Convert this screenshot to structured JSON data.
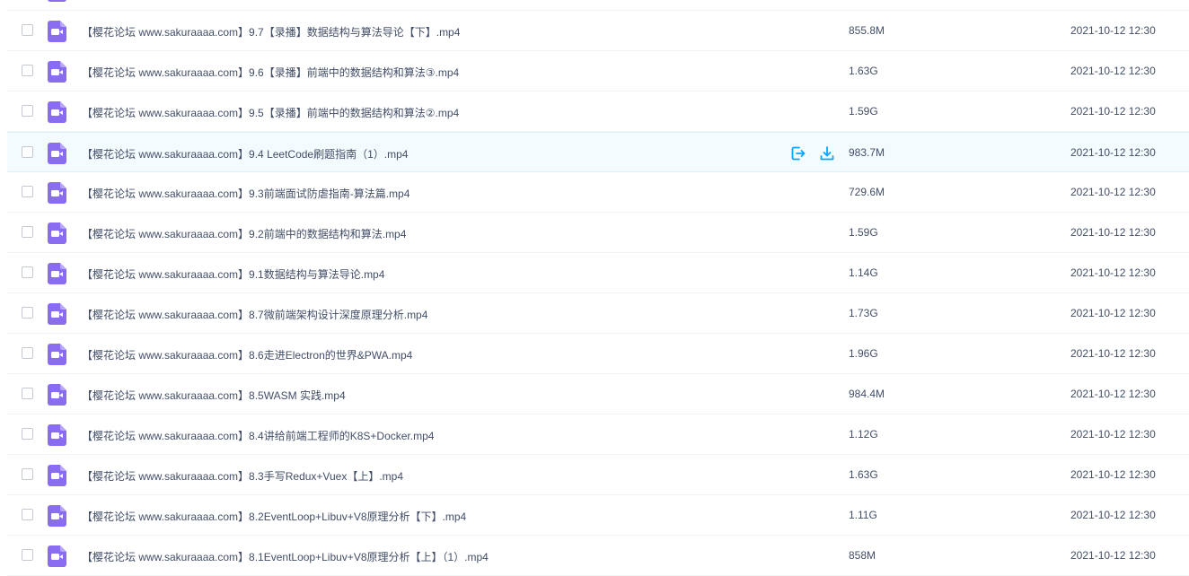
{
  "colors": {
    "accent": "#06a7ff",
    "file_icon": "#8a6cf0",
    "text": "#424e67"
  },
  "actions": {
    "share_icon": "share-icon",
    "download_icon": "download-icon"
  },
  "files": [
    {
      "name": "",
      "size": "",
      "date": ""
    },
    {
      "name": "【樱花论坛 www.sakuraaaa.com】9.7【录播】数据结构与算法导论【下】.mp4",
      "size": "855.8M",
      "date": "2021-10-12 12:30"
    },
    {
      "name": "【樱花论坛 www.sakuraaaa.com】9.6【录播】前端中的数据结构和算法③.mp4",
      "size": "1.63G",
      "date": "2021-10-12 12:30"
    },
    {
      "name": "【樱花论坛 www.sakuraaaa.com】9.5【录播】前端中的数据结构和算法②.mp4",
      "size": "1.59G",
      "date": "2021-10-12 12:30"
    },
    {
      "name": "【樱花论坛 www.sakuraaaa.com】9.4 LeetCode刷题指南（1）.mp4",
      "size": "983.7M",
      "date": "2021-10-12 12:30",
      "hover": true
    },
    {
      "name": "【樱花论坛 www.sakuraaaa.com】9.3前端面试防虐指南-算法篇.mp4",
      "size": "729.6M",
      "date": "2021-10-12 12:30"
    },
    {
      "name": "【樱花论坛 www.sakuraaaa.com】9.2前端中的数据结构和算法.mp4",
      "size": "1.59G",
      "date": "2021-10-12 12:30"
    },
    {
      "name": "【樱花论坛 www.sakuraaaa.com】9.1数据结构与算法导论.mp4",
      "size": "1.14G",
      "date": "2021-10-12 12:30"
    },
    {
      "name": "【樱花论坛 www.sakuraaaa.com】8.7微前端架构设计深度原理分析.mp4",
      "size": "1.73G",
      "date": "2021-10-12 12:30"
    },
    {
      "name": "【樱花论坛 www.sakuraaaa.com】8.6走进Electron的世界&PWA.mp4",
      "size": "1.96G",
      "date": "2021-10-12 12:30"
    },
    {
      "name": "【樱花论坛 www.sakuraaaa.com】8.5WASM 实践.mp4",
      "size": "984.4M",
      "date": "2021-10-12 12:30"
    },
    {
      "name": "【樱花论坛 www.sakuraaaa.com】8.4讲给前端工程师的K8S+Docker.mp4",
      "size": "1.12G",
      "date": "2021-10-12 12:30"
    },
    {
      "name": "【樱花论坛 www.sakuraaaa.com】8.3手写Redux+Vuex【上】.mp4",
      "size": "1.63G",
      "date": "2021-10-12 12:30"
    },
    {
      "name": "【樱花论坛 www.sakuraaaa.com】8.2EventLoop+Libuv+V8原理分析【下】.mp4",
      "size": "1.11G",
      "date": "2021-10-12 12:30"
    },
    {
      "name": "【樱花论坛 www.sakuraaaa.com】8.1EventLoop+Libuv+V8原理分析【上】（1）.mp4",
      "size": "858M",
      "date": "2021-10-12 12:30"
    }
  ]
}
